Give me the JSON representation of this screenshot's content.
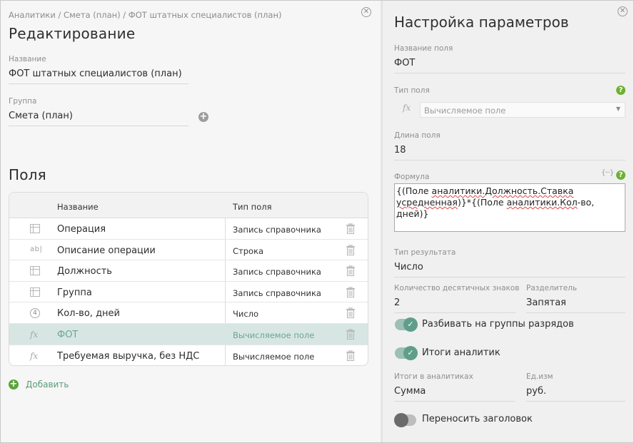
{
  "editor": {
    "breadcrumb": "Аналитики / Смета (план) / ФОТ штатных специалистов (план)",
    "title": "Редактирование",
    "name_label": "Название",
    "name_value": "ФОТ штатных специалистов (план)",
    "group_label": "Группа",
    "group_value": "Смета (план)",
    "fields_title": "Поля",
    "table": {
      "headers": {
        "name": "Название",
        "type": "Тип поля"
      },
      "rows": [
        {
          "icon": "directory-icon",
          "name": "Операция",
          "type": "Запись справочника",
          "selected": false
        },
        {
          "icon": "text-icon",
          "name": "Описание операции",
          "type": "Строка",
          "selected": false
        },
        {
          "icon": "directory-icon",
          "name": "Должность",
          "type": "Запись справочника",
          "selected": false
        },
        {
          "icon": "directory-icon",
          "name": "Группа",
          "type": "Запись справочника",
          "selected": false
        },
        {
          "icon": "number-icon",
          "name": "Кол-во, дней",
          "type": "Число",
          "selected": false
        },
        {
          "icon": "formula-icon",
          "name": "ФОТ",
          "type": "Вычисляемое поле",
          "selected": true
        },
        {
          "icon": "formula-icon",
          "name": "Требуемая выручка, без НДС",
          "type": "Вычисляемое поле",
          "selected": false
        }
      ]
    },
    "add_label": "Добавить",
    "abl_glyph": "ab|",
    "num_glyph": "4",
    "fx_glyph": "fx"
  },
  "settings": {
    "title": "Настройка параметров",
    "field_name_label": "Название поля",
    "field_name_value": "ФОТ",
    "field_type_label": "Тип поля",
    "field_type_value": "Вычисляемое поле",
    "length_label": "Длина поля",
    "length_value": "18",
    "formula_label": "Формула",
    "formula_parts": {
      "p1": "{(Поле ",
      "p2": "аналитики.Должность.Ставка",
      "p3": " ",
      "p4": "усредненная",
      "p5": ")}*{(Поле ",
      "p6": "аналитики.Кол",
      "p7": "-во, дней)}"
    },
    "result_type_label": "Тип результата",
    "result_type_value": "Число",
    "decimals_label": "Количество десятичных знаков",
    "decimals_value": "2",
    "separator_label": "Разделитель",
    "separator_value": "Запятая",
    "toggle_groups_label": "Разбивать на группы разрядов",
    "toggle_groups_on": true,
    "toggle_totals_label": "Итоги аналитик",
    "toggle_totals_on": true,
    "totals_in_label": "Итоги в аналитиках",
    "totals_in_value": "Сумма",
    "unit_label": "Ед.изм",
    "unit_value": "руб.",
    "toggle_wrap_label": "Переносить заголовок",
    "toggle_wrap_on": false
  },
  "colors": {
    "accent": "#5f9e8a",
    "help_green": "#6fb033",
    "add_green": "#5aa53a",
    "selected_row": "#d7e6e2"
  }
}
